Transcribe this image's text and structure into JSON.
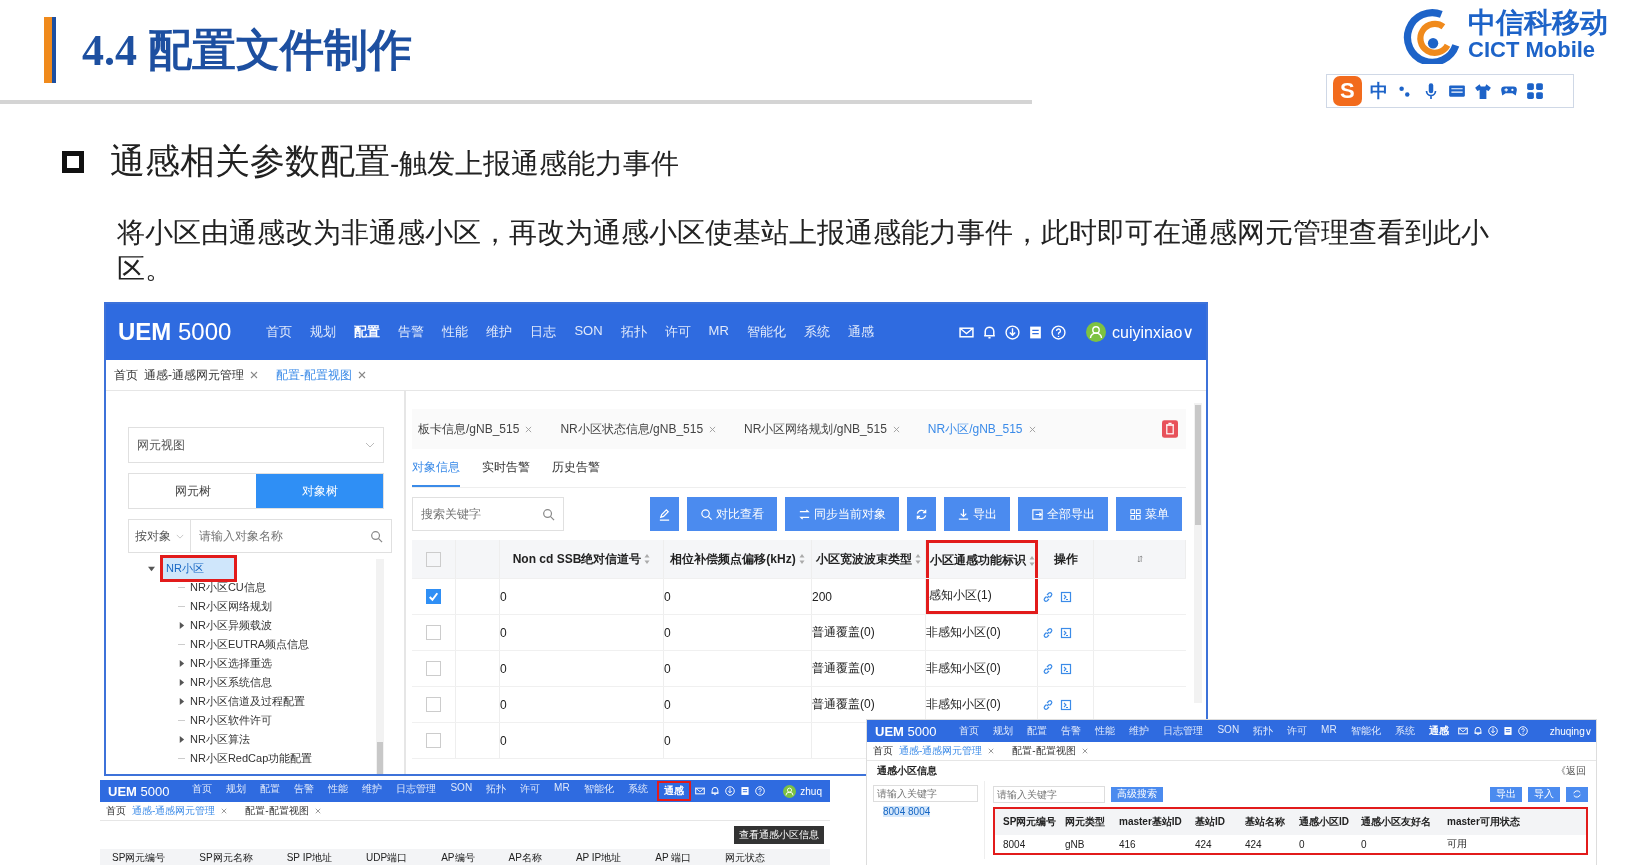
{
  "slide": {
    "title": "4.4 配置文件制作",
    "heading": "通感相关参数配置",
    "heading_sub": "-触发上报通感能力事件",
    "paragraph": "将小区由通感改为非通感小区，再改为通感小区使基站上报通感能力事件，此时即可在通感网元管理查看到此小区。"
  },
  "logo": {
    "name": "中信科移动",
    "subtitle": "CICT Mobile"
  },
  "ime_toolbar": {
    "badge": "S",
    "mode": "中"
  },
  "main_screenshot": {
    "header": {
      "brand": "UEM",
      "version": "5000",
      "user": "cuiyinxiao∨",
      "nav": [
        {
          "label": "首页",
          "selected": false
        },
        {
          "label": "规划",
          "selected": false
        },
        {
          "label": "配置",
          "selected": true
        },
        {
          "label": "告警",
          "selected": false
        },
        {
          "label": "性能",
          "selected": false
        },
        {
          "label": "维护",
          "selected": false
        },
        {
          "label": "日志",
          "selected": false
        },
        {
          "label": "SON",
          "selected": false
        },
        {
          "label": "拓扑",
          "selected": false
        },
        {
          "label": "许可",
          "selected": false
        },
        {
          "label": "MR",
          "selected": false
        },
        {
          "label": "智能化",
          "selected": false
        },
        {
          "label": "系统",
          "selected": false
        },
        {
          "label": "通感",
          "selected": false
        }
      ]
    },
    "breadcrumbs": [
      {
        "label": "首页",
        "selected": false,
        "closable": false
      },
      {
        "label": "通感-通感网元管理",
        "selected": false,
        "closable": true
      },
      {
        "label": "配置-配置视图",
        "selected": true,
        "closable": true
      }
    ],
    "left_panel": {
      "view_select": "网元视图",
      "toggle": [
        {
          "label": "网元树",
          "selected": false
        },
        {
          "label": "对象树",
          "selected": true
        }
      ],
      "filter": "按对象",
      "search_placeholder": "请输入对象名称",
      "tree": {
        "label": "NR小区",
        "selected": true,
        "highlighted": true,
        "children": [
          {
            "label": "NR小区CU信息",
            "kind": "leaf"
          },
          {
            "label": "NR小区网络规划",
            "kind": "leaf"
          },
          {
            "label": "NR小区异频载波",
            "kind": "folder"
          },
          {
            "label": "NR小区EUTRA频点信息",
            "kind": "leaf"
          },
          {
            "label": "NR小区选择重选",
            "kind": "folder"
          },
          {
            "label": "NR小区系统信息",
            "kind": "folder"
          },
          {
            "label": "NR小区信道及过程配置",
            "kind": "folder"
          },
          {
            "label": "NR小区软件许可",
            "kind": "leaf"
          },
          {
            "label": "NR小区算法",
            "kind": "folder"
          },
          {
            "label": "NR小区RedCap功能配置",
            "kind": "leaf"
          }
        ]
      }
    },
    "doc_tabs": [
      {
        "label": "板卡信息/gNB_515",
        "selected": false
      },
      {
        "label": "NR小区状态信息/gNB_515",
        "selected": false
      },
      {
        "label": "NR小区网络规划/gNB_515",
        "selected": false
      },
      {
        "label": "NR小区/gNB_515",
        "selected": true
      }
    ],
    "sub_tabs": [
      {
        "label": "对象信息",
        "selected": true
      },
      {
        "label": "实时告警",
        "selected": false
      },
      {
        "label": "历史告警",
        "selected": false
      }
    ],
    "search_placeholder": "搜索关键字",
    "toolbar": [
      {
        "kind": "edit"
      },
      {
        "kind": "compare",
        "label": "对比查看"
      },
      {
        "kind": "sync",
        "label": "同步当前对象"
      },
      {
        "kind": "refresh"
      },
      {
        "kind": "export",
        "label": "导出"
      },
      {
        "kind": "exportall",
        "label": "全部导出"
      },
      {
        "kind": "menu",
        "label": "菜单"
      }
    ],
    "table": {
      "select_all": {
        "checked": false
      },
      "columns": [
        {
          "label": "Non cd SSB绝对信道号",
          "sortable": true,
          "highlighted": false
        },
        {
          "label": "相位补偿频点偏移(kHz)",
          "sortable": true,
          "highlighted": false
        },
        {
          "label": "小区宽波波束类型",
          "sortable": true,
          "highlighted": false
        },
        {
          "label": "小区通感功能标识",
          "sortable": true,
          "highlighted": true
        },
        {
          "label": "操作",
          "sortable": false,
          "highlighted": false
        }
      ],
      "rows": [
        {
          "checked": true,
          "cells": [
            "0",
            "0",
            "200",
            "感知小区(1)"
          ]
        },
        {
          "checked": false,
          "cells": [
            "0",
            "0",
            "普通覆盖(0)",
            "非感知小区(0)"
          ]
        },
        {
          "checked": false,
          "cells": [
            "0",
            "0",
            "普通覆盖(0)",
            "非感知小区(0)"
          ]
        },
        {
          "checked": false,
          "cells": [
            "0",
            "0",
            "普通覆盖(0)",
            "非感知小区(0)"
          ]
        },
        {
          "checked": false,
          "cells": [
            "0",
            "0"
          ]
        }
      ]
    }
  },
  "bottom_left_screenshot": {
    "header": {
      "brand": "UEM",
      "version": "5000",
      "user": "zhuq",
      "nav": [
        {
          "label": "首页",
          "selected": false,
          "highlighted": false
        },
        {
          "label": "规划",
          "selected": false,
          "highlighted": false
        },
        {
          "label": "配置",
          "selected": false,
          "highlighted": false
        },
        {
          "label": "告警",
          "selected": false,
          "highlighted": false
        },
        {
          "label": "性能",
          "selected": false,
          "highlighted": false
        },
        {
          "label": "维护",
          "selected": false,
          "highlighted": false
        },
        {
          "label": "日志管理",
          "selected": false,
          "highlighted": false
        },
        {
          "label": "SON",
          "selected": false,
          "highlighted": false
        },
        {
          "label": "拓扑",
          "selected": false,
          "highlighted": false
        },
        {
          "label": "许可",
          "selected": false,
          "highlighted": false
        },
        {
          "label": "MR",
          "selected": false,
          "highlighted": false
        },
        {
          "label": "智能化",
          "selected": false,
          "highlighted": false
        },
        {
          "label": "系统",
          "selected": false,
          "highlighted": false
        },
        {
          "label": "通感",
          "selected": true,
          "highlighted": true
        }
      ]
    },
    "breadcrumbs": [
      {
        "label": "首页",
        "selected": false,
        "closable": false
      },
      {
        "label": "通感-通感网元管理",
        "selected": true,
        "closable": true
      },
      {
        "label": "配置-配置视图",
        "selected": false,
        "closable": true
      }
    ],
    "columns": [
      "SP网元编号",
      "SP网元名称",
      "SP IP地址",
      "UDP端口",
      "AP编号",
      "AP名称",
      "AP IP地址",
      "AP 端口",
      "网元状态"
    ],
    "tooltip": "查看通感小区信息"
  },
  "bottom_right_screenshot": {
    "header": {
      "brand": "UEM",
      "version": "5000",
      "user": "zhuqing∨",
      "nav": [
        {
          "label": "首页",
          "selected": false
        },
        {
          "label": "规划",
          "selected": false
        },
        {
          "label": "配置",
          "selected": false
        },
        {
          "label": "告警",
          "selected": false
        },
        {
          "label": "性能",
          "selected": false
        },
        {
          "label": "维护",
          "selected": false
        },
        {
          "label": "日志管理",
          "selected": false
        },
        {
          "label": "SON",
          "selected": false
        },
        {
          "label": "拓扑",
          "selected": false
        },
        {
          "label": "许可",
          "selected": false
        },
        {
          "label": "MR",
          "selected": false
        },
        {
          "label": "智能化",
          "selected": false
        },
        {
          "label": "系统",
          "selected": false
        },
        {
          "label": "通感",
          "selected": true
        }
      ]
    },
    "breadcrumbs": [
      {
        "label": "首页",
        "selected": false,
        "closable": false
      },
      {
        "label": "通感-通感网元管理",
        "selected": true,
        "closable": true
      },
      {
        "label": "配置-配置视图",
        "selected": false,
        "closable": true
      }
    ],
    "title": "通感小区信息",
    "back": "《返回",
    "tree_search_placeholder": "请输入关键字",
    "tree_item": "8004 8004",
    "search_placeholder": "请输入关键字",
    "advanced_search": "高级搜索",
    "export": "导出",
    "import": "导入",
    "table": {
      "highlighted": true,
      "columns": [
        "SP网元编号",
        "网元类型",
        "master基站ID",
        "基站ID",
        "基站名称",
        "通感小区ID",
        "通感小区友好名",
        "master可用状态"
      ],
      "rows": [
        [
          "8004",
          "gNB",
          "416",
          "424",
          "424",
          "0",
          "0",
          "可用"
        ]
      ]
    }
  }
}
